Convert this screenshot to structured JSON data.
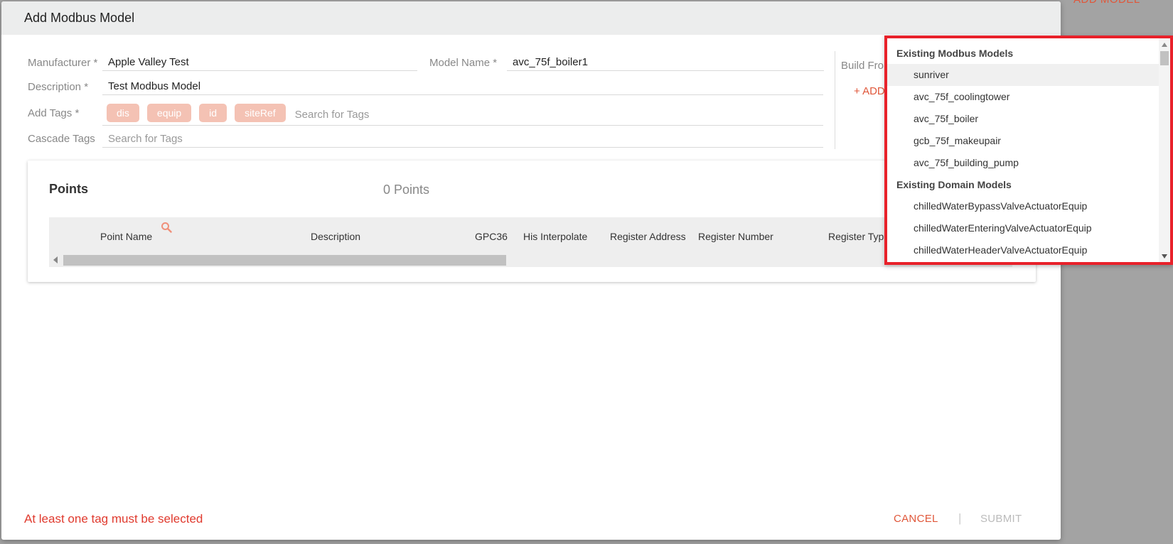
{
  "background": {
    "add_model_label": "ADD MODEL"
  },
  "modal": {
    "title": "Add Modbus Model",
    "form": {
      "manufacturer": {
        "label": "Manufacturer *",
        "value": "Apple Valley Test"
      },
      "model_name": {
        "label": "Model Name *",
        "value": "avc_75f_boiler1"
      },
      "description": {
        "label": "Description *",
        "value": "Test Modbus Model"
      },
      "add_tags": {
        "label": "Add Tags *",
        "tags": [
          "dis",
          "equip",
          "id",
          "siteRef"
        ],
        "placeholder": "Search for Tags"
      },
      "cascade_tags": {
        "label": "Cascade Tags",
        "placeholder": "Search for Tags"
      },
      "build_from": {
        "label": "Build From",
        "add_label": "+ ADD"
      }
    },
    "points": {
      "title": "Points",
      "count_label": "0 Points",
      "columns": [
        "Point Name",
        "Description",
        "GPC36",
        "His Interpolate",
        "Register Address",
        "Register Number",
        "Register Type"
      ]
    },
    "footer": {
      "error": "At least one tag must be selected",
      "cancel": "CANCEL",
      "separator": "|",
      "submit": "SUBMIT"
    }
  },
  "dropdown": {
    "groups": [
      {
        "label": "Existing Modbus Models",
        "items": [
          "sunriver",
          "avc_75f_coolingtower",
          "avc_75f_boiler",
          "gcb_75f_makeupair",
          "avc_75f_building_pump"
        ]
      },
      {
        "label": "Existing Domain Models",
        "items": [
          "chilledWaterBypassValveActuatorEquip",
          "chilledWaterEnteringValveActuatorEquip",
          "chilledWaterHeaderValveActuatorEquip"
        ]
      }
    ],
    "highlight_color": "#e8212a"
  },
  "colors": {
    "accent": "#e0573a",
    "error": "#e03a2e",
    "tag_bg": "#f4c2b4"
  }
}
